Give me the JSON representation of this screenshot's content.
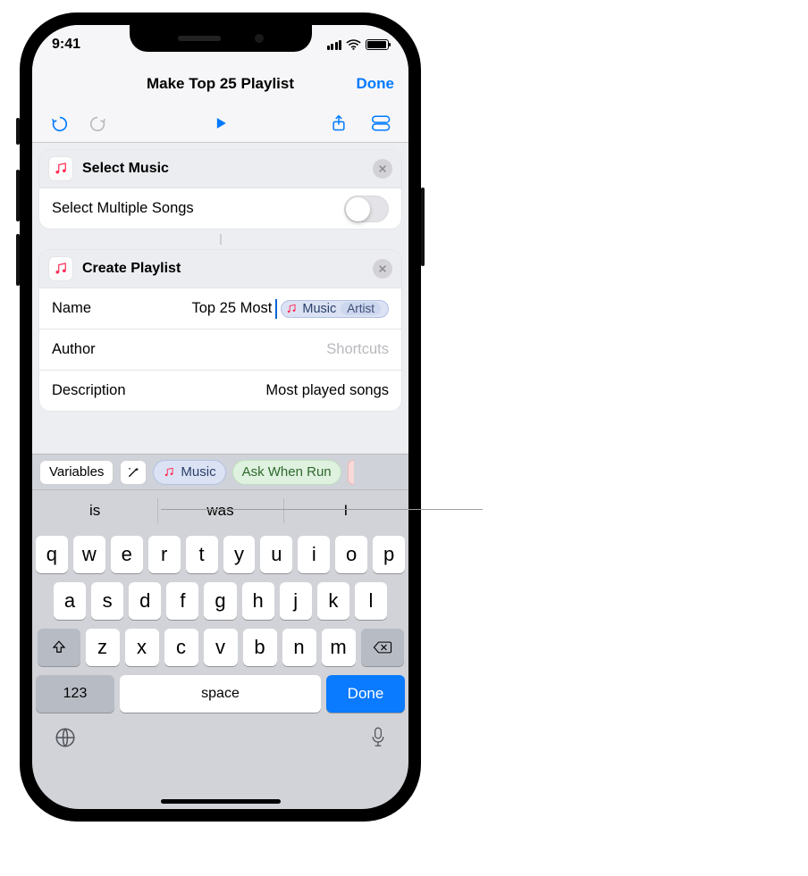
{
  "status": {
    "time": "9:41"
  },
  "nav": {
    "title": "Make Top 25 Playlist",
    "done": "Done"
  },
  "actions": {
    "select_music": {
      "title": "Select Music",
      "multiple_label": "Select Multiple Songs"
    },
    "create_playlist": {
      "title": "Create Playlist",
      "name_label": "Name",
      "name_text": "Top 25 Most",
      "name_token_var": "Music",
      "name_token_sub": "Artist",
      "author_label": "Author",
      "author_placeholder": "Shortcuts",
      "desc_label": "Description",
      "desc_value": "Most played songs"
    }
  },
  "varbar": {
    "variables": "Variables",
    "music": "Music",
    "ask": "Ask When Run"
  },
  "predictions": [
    "is",
    "was",
    "I"
  ],
  "keyboard": {
    "row1": [
      "q",
      "w",
      "e",
      "r",
      "t",
      "y",
      "u",
      "i",
      "o",
      "p"
    ],
    "row2": [
      "a",
      "s",
      "d",
      "f",
      "g",
      "h",
      "j",
      "k",
      "l"
    ],
    "row3": [
      "z",
      "x",
      "c",
      "v",
      "b",
      "n",
      "m"
    ],
    "num": "123",
    "space": "space",
    "done": "Done"
  }
}
